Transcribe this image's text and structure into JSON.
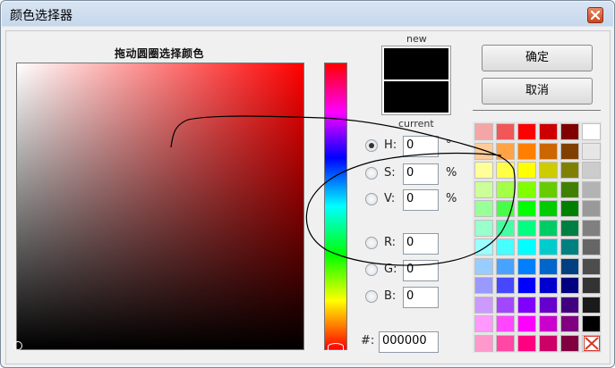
{
  "window": {
    "title": "颜色选择器"
  },
  "picker": {
    "label": "拖动圆圈选择颜色",
    "hue_marker_position": "bottom",
    "sv_marker_position": "bottom-left"
  },
  "preview": {
    "new_label": "new",
    "current_label": "current",
    "new_color": "#000000",
    "current_color": "#000000"
  },
  "fields": {
    "h": {
      "label": "H:",
      "value": "0",
      "unit": "°",
      "checked": true
    },
    "s": {
      "label": "S:",
      "value": "0",
      "unit": "%",
      "checked": false
    },
    "v": {
      "label": "V:",
      "value": "0",
      "unit": "%",
      "checked": false
    },
    "r": {
      "label": "R:",
      "value": "0",
      "checked": false
    },
    "g": {
      "label": "G:",
      "value": "0",
      "checked": false
    },
    "b": {
      "label": "B:",
      "value": "0",
      "checked": false
    }
  },
  "hex": {
    "label": "#:",
    "value": "000000"
  },
  "buttons": {
    "ok": "确定",
    "cancel": "取消"
  },
  "palette": {
    "columns": 6,
    "colors": [
      "#f4a6a6",
      "#f25757",
      "#ff0000",
      "#cc0000",
      "#800000",
      "#ffffff",
      "#ffcc99",
      "#ffa347",
      "#ff8000",
      "#cc6600",
      "#804000",
      "#e6e6e6",
      "#ffff99",
      "#ffff47",
      "#ffff00",
      "#cccc00",
      "#808000",
      "#cccccc",
      "#ccff99",
      "#a3ff47",
      "#80ff00",
      "#66cc00",
      "#408000",
      "#b3b3b3",
      "#99ff99",
      "#47ff47",
      "#00ff00",
      "#00cc00",
      "#008000",
      "#999999",
      "#99ffcc",
      "#47ffa3",
      "#00ff80",
      "#00cc66",
      "#008040",
      "#808080",
      "#99ffff",
      "#47ffff",
      "#00ffff",
      "#00cccc",
      "#008080",
      "#666666",
      "#99ccff",
      "#47a3ff",
      "#0080ff",
      "#0066cc",
      "#004080",
      "#4d4d4d",
      "#9999ff",
      "#4747ff",
      "#0000ff",
      "#0000cc",
      "#000080",
      "#333333",
      "#cc99ff",
      "#a347ff",
      "#8000ff",
      "#6600cc",
      "#400080",
      "#1a1a1a",
      "#ff99ff",
      "#ff47ff",
      "#ff00ff",
      "#cc00cc",
      "#800080",
      "#000000",
      "#ff99cc",
      "#ff47a3",
      "#ff0080",
      "#cc0066",
      "#800040",
      "none"
    ]
  }
}
